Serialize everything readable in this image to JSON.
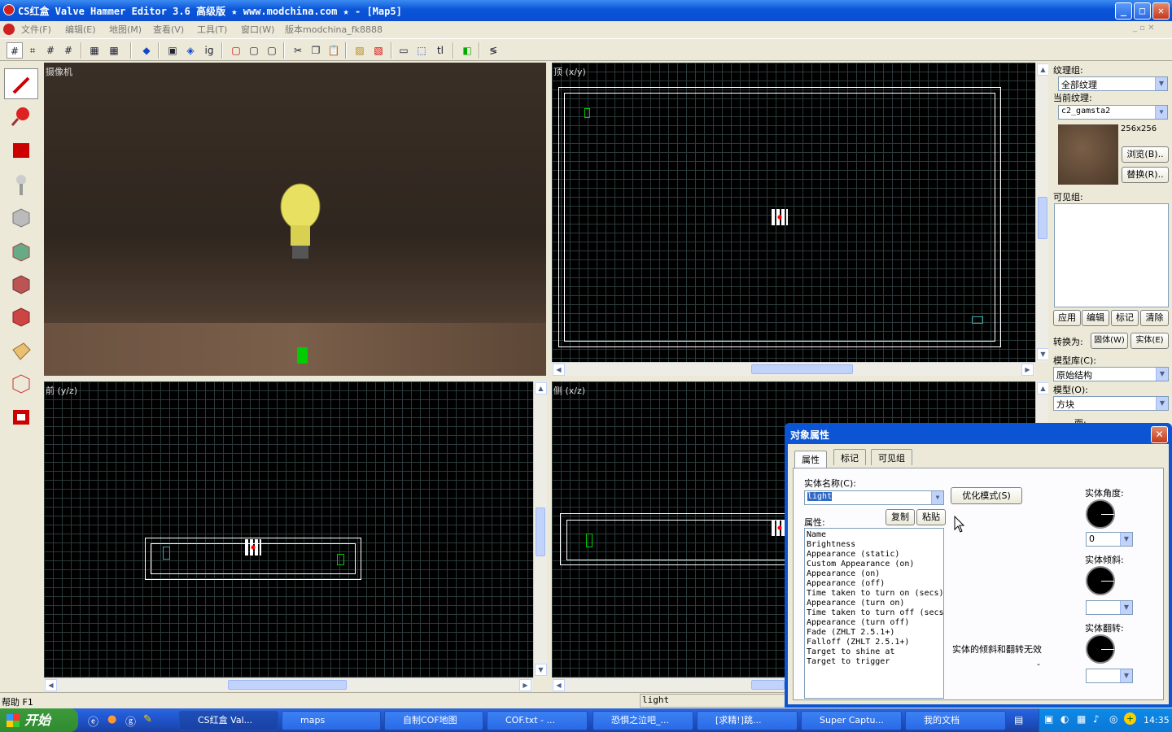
{
  "window": {
    "title": "CS红盒 Valve Hammer Editor 3.6 高级版 ★ www.modchina.com ★ - [Map5]",
    "min": "_",
    "max": "□",
    "close": "✕"
  },
  "menu": {
    "items": [
      "文件(F)",
      "编辑(E)",
      "地图(M)",
      "查看(V)",
      "工具(T)",
      "窗口(W)",
      "版本modchina_fk8888"
    ]
  },
  "viewports": {
    "camera": {
      "label": "摄像机"
    },
    "top": {
      "label": "顶 (x/y)"
    },
    "front": {
      "label": "前 (y/z)"
    },
    "side": {
      "label": "侧 (x/z)"
    }
  },
  "right_panel": {
    "texture_group_label": "纹理组:",
    "texture_group_value": "全部纹理",
    "current_texture_label": "当前纹理:",
    "current_texture_value": "c2_gamsta2",
    "texture_size": "256x256",
    "browse_button": "浏览(B)..",
    "replace_button": "替换(R)..",
    "visgroup_label": "可见组:",
    "apply_button": "应用",
    "edit_button": "编辑",
    "mark_button": "标记",
    "clear_button": "清除",
    "convert_label": "转换为:",
    "to_solid_button": "固体(W)",
    "to_entity_button": "实体(E)",
    "prefab_lib_label": "模型库(C):",
    "prefab_lib_value": "原始结构",
    "prefab_label": "模型(O):",
    "prefab_value": "方块",
    "faces_label": "面:"
  },
  "status": {
    "help": "帮助 F1",
    "selection": "light"
  },
  "dialog": {
    "title": "对象属性",
    "tabs": [
      "属性",
      "标记",
      "可见组"
    ],
    "classname_label": "实体名称(C):",
    "classname_value": "light",
    "smartedit_button": "优化模式(S)",
    "attributes_label": "属性:",
    "copy_button": "复制",
    "paste_button": "粘贴",
    "keyvalues": [
      "Name",
      "Brightness",
      "Appearance (static)",
      "Custom Appearance (on)",
      "Appearance (on)",
      "Appearance (off)",
      "Time taken to turn on (secs)",
      "Appearance (turn on)",
      "Time taken to turn off (secs",
      "Appearance (turn off)",
      "Fade (ZHLT 2.5.1+)",
      "Falloff (ZHLT 2.5.1+)",
      "Target to shine at",
      "Target to trigger"
    ],
    "angle_label": "实体角度:",
    "angle_value": "0",
    "pitch_label": "实体倾斜:",
    "roll_label": "实体翻转:",
    "note": "实体的倾斜和翻转无效",
    "dash": "-"
  },
  "taskbar": {
    "start": "开始",
    "tasks": [
      "CS红盒 Val...",
      "maps",
      "自制COF地图",
      "COF.txt - ...",
      "恐惧之泣吧_...",
      "[求精!]跳...",
      "Super Captu...",
      "我的文档"
    ],
    "clock": "14:35"
  },
  "colors": {
    "title_blue": "#0a55d8",
    "grid_line": "#2a3a3a",
    "selection_white": "#ffffff",
    "entity_green": "#00cc00"
  }
}
